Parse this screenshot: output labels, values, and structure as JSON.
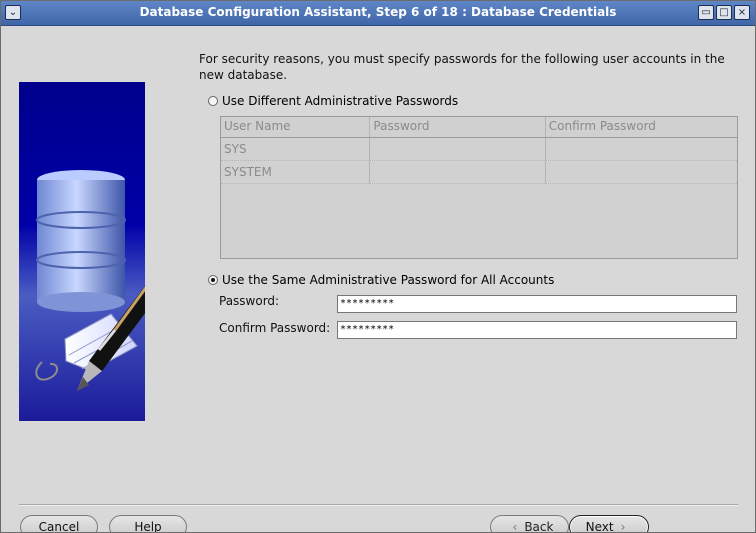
{
  "window": {
    "title": "Database Configuration Assistant, Step 6 of 18 : Database Credentials",
    "controls": {
      "menu": "⌄",
      "minimize": "▭",
      "maximize": "□",
      "close": "×"
    }
  },
  "intro": "For security reasons, you must specify passwords for the following user accounts in the new database.",
  "options": {
    "different": "Use Different Administrative Passwords",
    "same": "Use the Same Administrative Password for All Accounts"
  },
  "table": {
    "headers": [
      "User Name",
      "Password",
      "Confirm Password"
    ],
    "rows": [
      [
        "SYS",
        "",
        ""
      ],
      [
        "SYSTEM",
        "",
        ""
      ]
    ]
  },
  "fields": {
    "password_label": "Password:",
    "password_value": "*********",
    "confirm_label": "Confirm Password:",
    "confirm_value": "*********"
  },
  "buttons": {
    "cancel": "Cancel",
    "help": "Help",
    "back": "Back",
    "next": "Next"
  },
  "icons": {
    "back": "‹",
    "next": "›"
  }
}
